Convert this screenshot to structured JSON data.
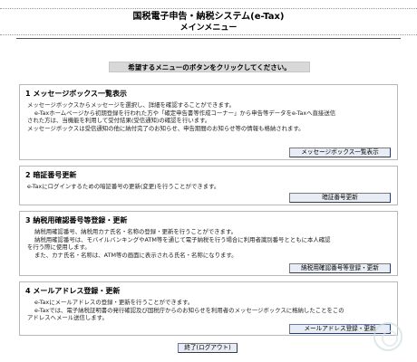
{
  "header": {
    "title": "国税電子申告・納税システム(e-Tax)",
    "subtitle": "メインメニュー"
  },
  "instruction": "希望するメニューのボタンをクリックしてください。",
  "sections": [
    {
      "heading": "1 メッセージボックス一覧表示",
      "lines": [
        "メッセージボックスからメッセージを選択し、詳細を確認することができます。",
        "e-Taxホームページから初期登録を行われた方や「確定申告書等作成コーナー」から申告等データをe-Taxへ直接送信",
        "された方は、当機能を利用して受付結果(受信通知)の確認を行います。",
        "メッセージボックスは受信通知の他に納付完了のお知らせ、申告期間のお知らせ等の情報も格納されます。"
      ],
      "button": "メッセージボックス一覧表示"
    },
    {
      "heading": "2 暗証番号更新",
      "lines": [
        "e-Taxにログインするための暗証番号の更新(変更)を行うことができます。"
      ],
      "button": "暗証番号更新"
    },
    {
      "heading": "3 納税用確認番号等登録・更新",
      "lines": [
        "納税用確認番号、納税用カナ氏名・名称の登録・更新を行うことができます。",
        "納税用確認番号は、モバイルバンキングやATM等を通じて電子納税を行う場合に利用者識別番号とともに本人確認",
        "を行う際に使用します。",
        "また、カナ氏名・名称は、ATM等の画面に表示される氏名・名称になります。"
      ],
      "button": "納税用確認番号等登録・更新"
    },
    {
      "heading": "4 メールアドレス登録・更新",
      "lines": [
        "e-Taxにメールアドレスの登録・更新を行うことができます。",
        "e-Taxでは、電子納税証明書の発行確認及び国税庁からのお知らせを利用者のメッセージボックスに格納したことをこの",
        "アドレスへメール送信します。"
      ],
      "button": "メールアドレス登録・更新"
    }
  ],
  "logout_label": "終了(ログアウト)",
  "colors": {
    "button_bg": "#e8ecf4",
    "button_border": "#2f3b5c",
    "instruction_bg": "#d8d8d8",
    "panel_border": "#b8b8b8"
  },
  "icons": {
    "watermark": "circular-emblem-icon"
  }
}
